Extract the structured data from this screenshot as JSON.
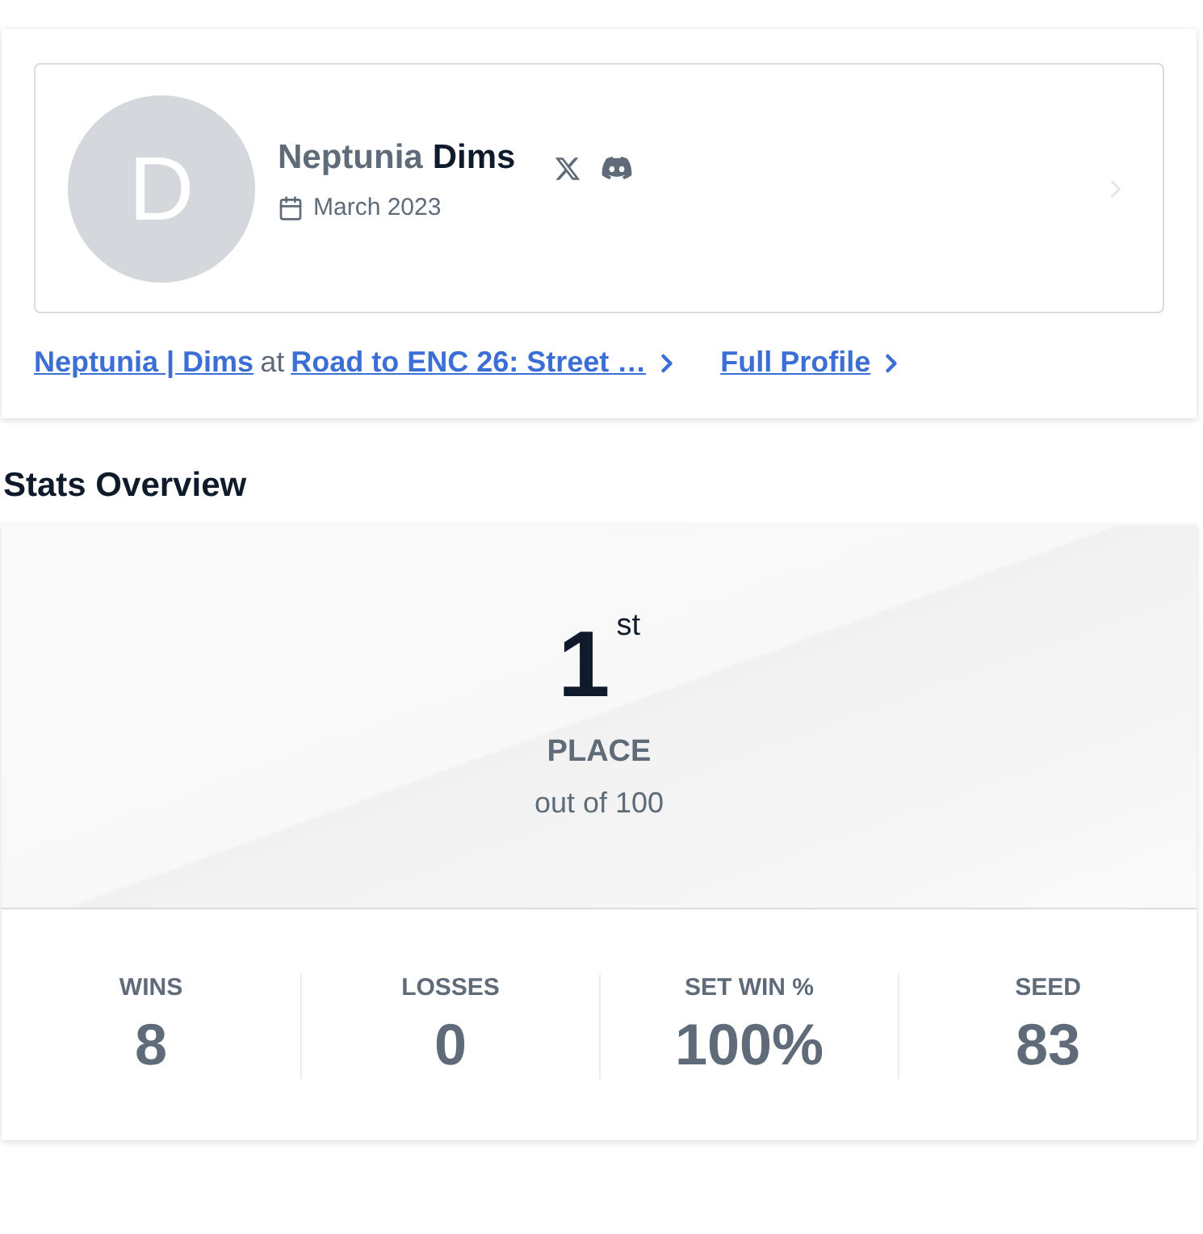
{
  "profile": {
    "avatar_initial": "D",
    "prefix": "Neptunia",
    "gamer_tag": "Dims",
    "joined": "March 2023",
    "socials": [
      {
        "kind": "x"
      },
      {
        "kind": "discord"
      }
    ]
  },
  "links": {
    "entrant": "Neptunia | Dims",
    "connector": "at",
    "event": "Road to ENC 26: Street …",
    "full_profile": "Full Profile"
  },
  "stats_overview": {
    "title": "Stats Overview",
    "placement": "1",
    "placement_suffix": "st",
    "placement_label": "PLACE",
    "out_of": "out of 100",
    "stats": [
      {
        "label": "WINS",
        "value": "8"
      },
      {
        "label": "LOSSES",
        "value": "0"
      },
      {
        "label": "SET WIN %",
        "value": "100%"
      },
      {
        "label": "SEED",
        "value": "83"
      }
    ]
  }
}
